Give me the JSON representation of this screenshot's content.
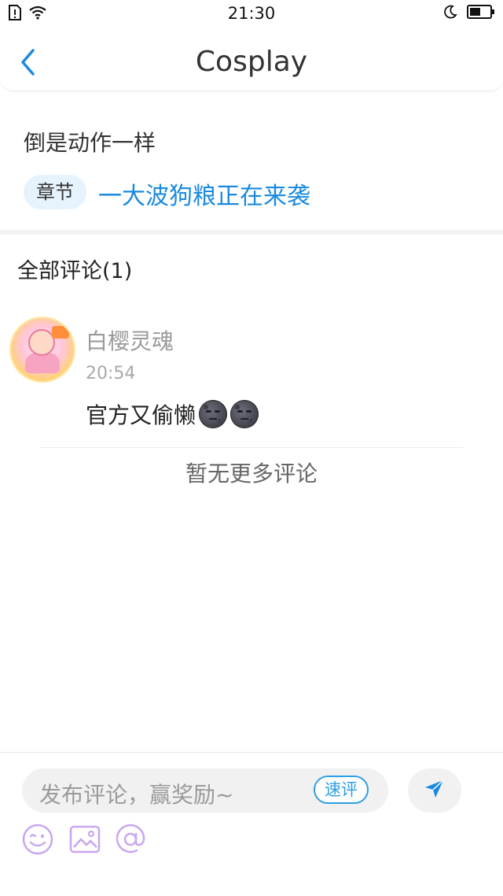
{
  "status_bar": {
    "time": "21:30",
    "left_icons": [
      "sim-alert-icon",
      "wifi-icon"
    ],
    "right_icons": [
      "moon-icon",
      "battery-icon"
    ]
  },
  "header": {
    "back_icon": "chevron-left-icon",
    "title": "Cosplay"
  },
  "post": {
    "text": "倒是动作一样",
    "chapter_tag": "章节",
    "chapter_title": "一大波狗粮正在来袭"
  },
  "comments": {
    "title": "全部评论(1)",
    "items": [
      {
        "username": "白樱灵魂",
        "time": "20:54",
        "text": "官方又偷懒",
        "emojis": [
          "new-moon-face-emoji",
          "new-moon-face-emoji"
        ]
      }
    ],
    "no_more": "暂无更多评论"
  },
  "bottom_bar": {
    "input_placeholder": "发布评论，赢奖励~",
    "quick_review_label": "速评",
    "send_icon": "send-icon",
    "tools": [
      "emoji-icon",
      "image-icon",
      "at-icon"
    ]
  },
  "colors": {
    "accent_blue": "#1a8ae0",
    "tool_purple": "#c9a6ef",
    "tag_bg": "#e7f3fc"
  }
}
